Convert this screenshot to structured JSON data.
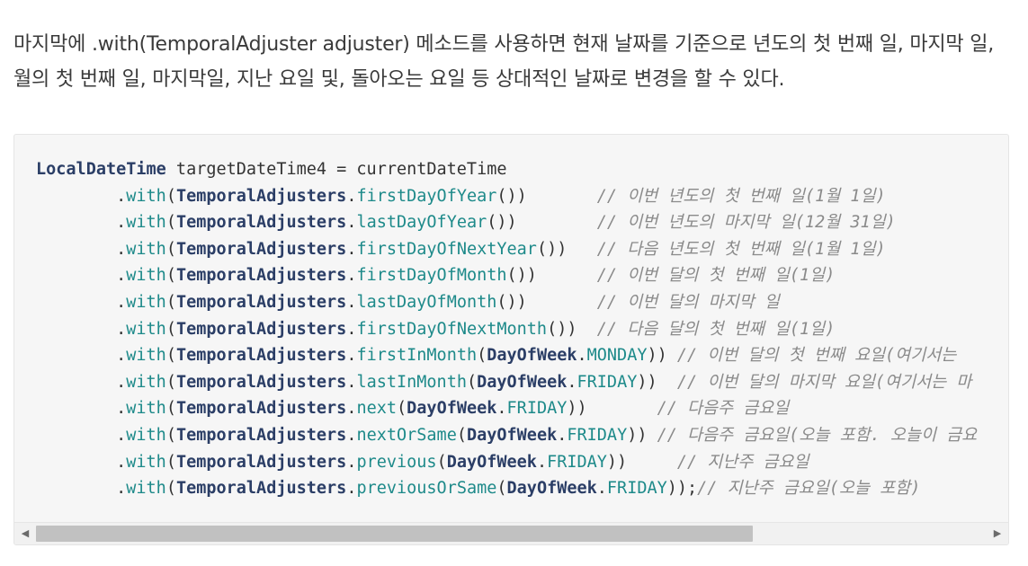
{
  "paragraph": "마지막에 .with(TemporalAdjuster adjuster) 메소드를 사용하면 현재 날짜를 기준으로 년도의 첫 번째 일, 마지막 일, 월의 첫 번째 일, 마지막일, 지난 요일 및, 돌아오는 요일 등 상대적인 날짜로 변경을 할 수 있다.",
  "code": {
    "lines": [
      [
        {
          "t": "LocalDateTime",
          "c": "type"
        },
        {
          "t": " targetDateTime4 = currentDateTime",
          "c": "plain"
        }
      ],
      [
        {
          "t": "        .",
          "c": "plain"
        },
        {
          "t": "with",
          "c": "method"
        },
        {
          "t": "(",
          "c": "plain"
        },
        {
          "t": "TemporalAdjusters",
          "c": "type"
        },
        {
          "t": ".",
          "c": "plain"
        },
        {
          "t": "firstDayOfYear",
          "c": "method"
        },
        {
          "t": "())       ",
          "c": "plain"
        },
        {
          "t": "// 이번 년도의 첫 번째 일(1월 1일)",
          "c": "comment"
        }
      ],
      [
        {
          "t": "        .",
          "c": "plain"
        },
        {
          "t": "with",
          "c": "method"
        },
        {
          "t": "(",
          "c": "plain"
        },
        {
          "t": "TemporalAdjusters",
          "c": "type"
        },
        {
          "t": ".",
          "c": "plain"
        },
        {
          "t": "lastDayOfYear",
          "c": "method"
        },
        {
          "t": "())        ",
          "c": "plain"
        },
        {
          "t": "// 이번 년도의 마지막 일(12월 31일)",
          "c": "comment"
        }
      ],
      [
        {
          "t": "        .",
          "c": "plain"
        },
        {
          "t": "with",
          "c": "method"
        },
        {
          "t": "(",
          "c": "plain"
        },
        {
          "t": "TemporalAdjusters",
          "c": "type"
        },
        {
          "t": ".",
          "c": "plain"
        },
        {
          "t": "firstDayOfNextYear",
          "c": "method"
        },
        {
          "t": "())   ",
          "c": "plain"
        },
        {
          "t": "// 다음 년도의 첫 번째 일(1월 1일)",
          "c": "comment"
        }
      ],
      [
        {
          "t": "        .",
          "c": "plain"
        },
        {
          "t": "with",
          "c": "method"
        },
        {
          "t": "(",
          "c": "plain"
        },
        {
          "t": "TemporalAdjusters",
          "c": "type"
        },
        {
          "t": ".",
          "c": "plain"
        },
        {
          "t": "firstDayOfMonth",
          "c": "method"
        },
        {
          "t": "())      ",
          "c": "plain"
        },
        {
          "t": "// 이번 달의 첫 번째 일(1일)",
          "c": "comment"
        }
      ],
      [
        {
          "t": "        .",
          "c": "plain"
        },
        {
          "t": "with",
          "c": "method"
        },
        {
          "t": "(",
          "c": "plain"
        },
        {
          "t": "TemporalAdjusters",
          "c": "type"
        },
        {
          "t": ".",
          "c": "plain"
        },
        {
          "t": "lastDayOfMonth",
          "c": "method"
        },
        {
          "t": "())       ",
          "c": "plain"
        },
        {
          "t": "// 이번 달의 마지막 일",
          "c": "comment"
        }
      ],
      [
        {
          "t": "        .",
          "c": "plain"
        },
        {
          "t": "with",
          "c": "method"
        },
        {
          "t": "(",
          "c": "plain"
        },
        {
          "t": "TemporalAdjusters",
          "c": "type"
        },
        {
          "t": ".",
          "c": "plain"
        },
        {
          "t": "firstDayOfNextMonth",
          "c": "method"
        },
        {
          "t": "())  ",
          "c": "plain"
        },
        {
          "t": "// 다음 달의 첫 번째 일(1일)",
          "c": "comment"
        }
      ],
      [
        {
          "t": "        .",
          "c": "plain"
        },
        {
          "t": "with",
          "c": "method"
        },
        {
          "t": "(",
          "c": "plain"
        },
        {
          "t": "TemporalAdjusters",
          "c": "type"
        },
        {
          "t": ".",
          "c": "plain"
        },
        {
          "t": "firstInMonth",
          "c": "method"
        },
        {
          "t": "(",
          "c": "plain"
        },
        {
          "t": "DayOfWeek",
          "c": "type"
        },
        {
          "t": ".",
          "c": "plain"
        },
        {
          "t": "MONDAY",
          "c": "const"
        },
        {
          "t": ")) ",
          "c": "plain"
        },
        {
          "t": "// 이번 달의 첫 번째 요일(여기서는 ",
          "c": "comment"
        }
      ],
      [
        {
          "t": "        .",
          "c": "plain"
        },
        {
          "t": "with",
          "c": "method"
        },
        {
          "t": "(",
          "c": "plain"
        },
        {
          "t": "TemporalAdjusters",
          "c": "type"
        },
        {
          "t": ".",
          "c": "plain"
        },
        {
          "t": "lastInMonth",
          "c": "method"
        },
        {
          "t": "(",
          "c": "plain"
        },
        {
          "t": "DayOfWeek",
          "c": "type"
        },
        {
          "t": ".",
          "c": "plain"
        },
        {
          "t": "FRIDAY",
          "c": "const"
        },
        {
          "t": "))  ",
          "c": "plain"
        },
        {
          "t": "// 이번 달의 마지막 요일(여기서는 마",
          "c": "comment"
        }
      ],
      [
        {
          "t": "        .",
          "c": "plain"
        },
        {
          "t": "with",
          "c": "method"
        },
        {
          "t": "(",
          "c": "plain"
        },
        {
          "t": "TemporalAdjusters",
          "c": "type"
        },
        {
          "t": ".",
          "c": "plain"
        },
        {
          "t": "next",
          "c": "method"
        },
        {
          "t": "(",
          "c": "plain"
        },
        {
          "t": "DayOfWeek",
          "c": "type"
        },
        {
          "t": ".",
          "c": "plain"
        },
        {
          "t": "FRIDAY",
          "c": "const"
        },
        {
          "t": "))       ",
          "c": "plain"
        },
        {
          "t": "// 다음주 금요일",
          "c": "comment"
        }
      ],
      [
        {
          "t": "        .",
          "c": "plain"
        },
        {
          "t": "with",
          "c": "method"
        },
        {
          "t": "(",
          "c": "plain"
        },
        {
          "t": "TemporalAdjusters",
          "c": "type"
        },
        {
          "t": ".",
          "c": "plain"
        },
        {
          "t": "nextOrSame",
          "c": "method"
        },
        {
          "t": "(",
          "c": "plain"
        },
        {
          "t": "DayOfWeek",
          "c": "type"
        },
        {
          "t": ".",
          "c": "plain"
        },
        {
          "t": "FRIDAY",
          "c": "const"
        },
        {
          "t": ")) ",
          "c": "plain"
        },
        {
          "t": "// 다음주 금요일(오늘 포함. 오늘이 금요",
          "c": "comment"
        }
      ],
      [
        {
          "t": "        .",
          "c": "plain"
        },
        {
          "t": "with",
          "c": "method"
        },
        {
          "t": "(",
          "c": "plain"
        },
        {
          "t": "TemporalAdjusters",
          "c": "type"
        },
        {
          "t": ".",
          "c": "plain"
        },
        {
          "t": "previous",
          "c": "method"
        },
        {
          "t": "(",
          "c": "plain"
        },
        {
          "t": "DayOfWeek",
          "c": "type"
        },
        {
          "t": ".",
          "c": "plain"
        },
        {
          "t": "FRIDAY",
          "c": "const"
        },
        {
          "t": "))     ",
          "c": "plain"
        },
        {
          "t": "// 지난주 금요일",
          "c": "comment"
        }
      ],
      [
        {
          "t": "        .",
          "c": "plain"
        },
        {
          "t": "with",
          "c": "method"
        },
        {
          "t": "(",
          "c": "plain"
        },
        {
          "t": "TemporalAdjusters",
          "c": "type"
        },
        {
          "t": ".",
          "c": "plain"
        },
        {
          "t": "previousOrSame",
          "c": "method"
        },
        {
          "t": "(",
          "c": "plain"
        },
        {
          "t": "DayOfWeek",
          "c": "type"
        },
        {
          "t": ".",
          "c": "plain"
        },
        {
          "t": "FRIDAY",
          "c": "const"
        },
        {
          "t": "));",
          "c": "plain"
        },
        {
          "t": "// 지난주 금요일(오늘 포함)",
          "c": "comment"
        }
      ]
    ]
  },
  "scrollbar": {
    "left_arrow_icon": "triangle-left-icon",
    "right_arrow_icon": "triangle-right-icon",
    "left_glyph": "◀",
    "right_glyph": "▶",
    "thumb_fraction": 0.754
  },
  "colors": {
    "type": "#2b3e66",
    "method": "#1e8a8a",
    "comment": "#8a8a8a",
    "code_background": "#f6f6f6"
  }
}
